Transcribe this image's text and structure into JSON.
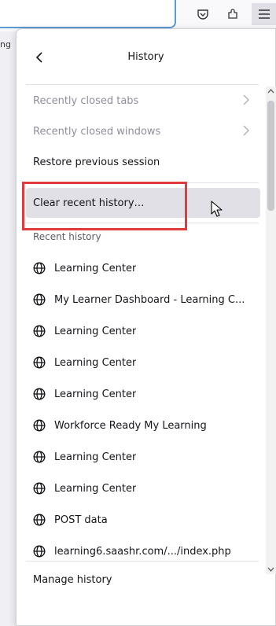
{
  "toolbar": {
    "icons": [
      "pocket-icon",
      "extensions-icon",
      "menu-icon"
    ]
  },
  "behind": {
    "fragment": "ng"
  },
  "panel": {
    "title": "History",
    "back_icon": "chevron-left-icon",
    "menu": [
      {
        "label": "Recently closed tabs",
        "disabled": true,
        "submenu": true
      },
      {
        "label": "Recently closed windows",
        "disabled": true,
        "submenu": true
      },
      {
        "label": "Restore previous session",
        "disabled": false,
        "submenu": false
      }
    ],
    "clear_history_label": "Clear recent history…",
    "section_label": "Recent history",
    "history_items": [
      "Learning Center",
      "My Learner Dashboard - Learning C...",
      "Learning Center",
      "Learning Center",
      "Learning Center",
      "Workforce Ready My Learning",
      "Learning Center",
      "Learning Center",
      "POST data",
      "learning6.saashr.com/.../index.php"
    ],
    "footer_label": "Manage history"
  },
  "colors": {
    "highlight_box": "#e03a3a",
    "hover_row": "#e0e0e6",
    "urlbar_border": "#5b9bd5"
  }
}
